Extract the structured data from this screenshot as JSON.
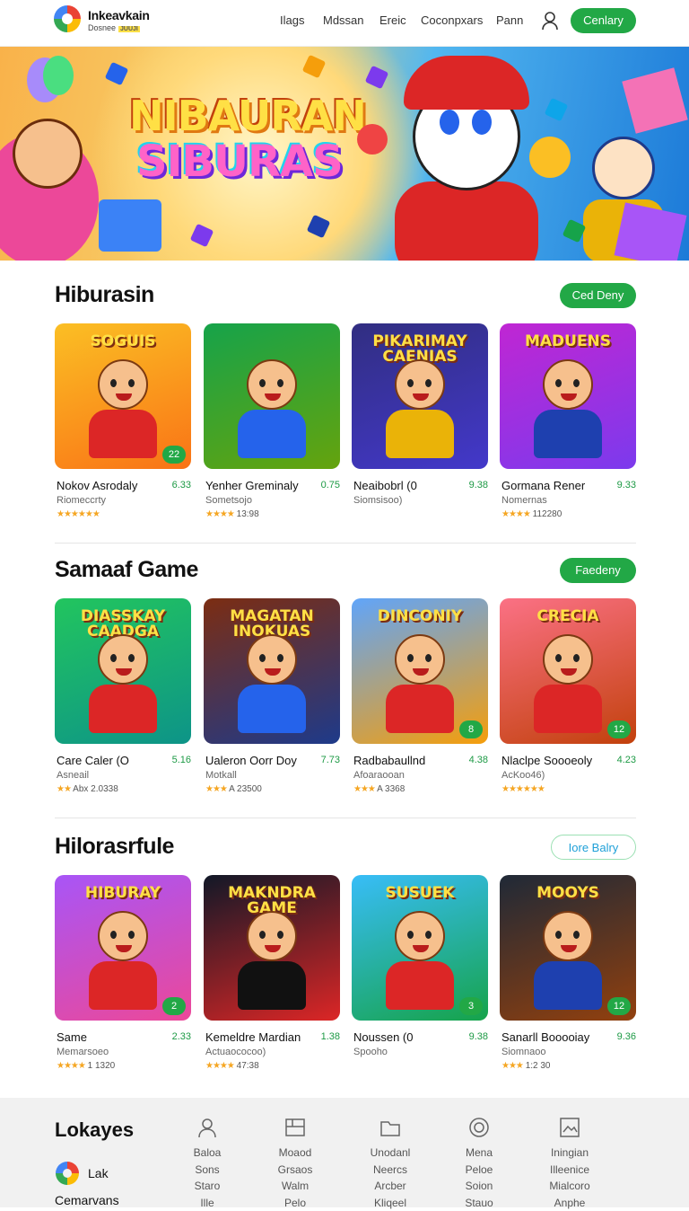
{
  "header": {
    "brand": "Inkeavkain",
    "brand_sub": "Dosnee",
    "brand_tag": "JUUJI",
    "nav": [
      "Ilags",
      "Mdssan",
      "Ereic",
      "Coconpxars",
      "Pann"
    ],
    "cta": "Cenlary",
    "icons": [
      "user-icon"
    ]
  },
  "hero": {
    "title_line1": "NIBAURAN",
    "title_line2": "SIBURAS"
  },
  "sections": [
    {
      "title": "Hiburasin",
      "button": "Ced Deny",
      "cards": [
        {
          "name": "Nokov Asrodaly",
          "score": "6.33",
          "sub": "Riomeccrty",
          "stars": "★★★★★★",
          "rating": "",
          "badge": "22"
        },
        {
          "name": "Yenher Greminaly",
          "score": "0.75",
          "sub": "Sometsojo",
          "stars": "★★★★",
          "rating": "13:98",
          "badge": ""
        },
        {
          "name": "Neaibobrl (0",
          "score": "9.38",
          "sub": "Siomsisoo)",
          "stars": "",
          "rating": "",
          "badge": ""
        },
        {
          "name": "Gormana Rener",
          "score": "9.33",
          "sub": "Nomernas",
          "stars": "★★★★",
          "rating": "112280",
          "badge": ""
        }
      ]
    },
    {
      "title": "Samaaf Game",
      "button": "Faedeny",
      "cards": [
        {
          "name": "Care Caler (O",
          "score": "5.16",
          "sub": "Asneail",
          "stars": "★★",
          "rating": "Abx 2.0338",
          "badge": ""
        },
        {
          "name": "Ualeron Oorr Doy",
          "score": "7.73",
          "sub": "Motkall",
          "stars": "★★★",
          "rating": "A 23500",
          "badge": ""
        },
        {
          "name": "Radbabaullnd",
          "score": "4.38",
          "sub": "Afoaraooan",
          "stars": "★★★",
          "rating": "A 3368",
          "badge": "8"
        },
        {
          "name": "Nlaclpe Soooeoly",
          "score": "4.23",
          "sub": "AcKoo46)",
          "stars": "★★★★★★",
          "rating": "",
          "badge": "12"
        }
      ]
    },
    {
      "title": "Hilorasrfule",
      "button": "Iore Balry",
      "cards": [
        {
          "name": "Same",
          "score": "2.33",
          "sub": "Memarsoeo",
          "stars": "★★★★",
          "rating": "1 1320",
          "badge": "2"
        },
        {
          "name": "Kemeldre Mardian",
          "score": "1.38",
          "sub": "Actuaococoo)",
          "stars": "★★★★",
          "rating": "47:38",
          "badge": ""
        },
        {
          "name": "Noussen (0",
          "score": "9.38",
          "sub": "Spooho",
          "stars": "",
          "rating": "",
          "badge": "3"
        },
        {
          "name": "Sanarll Booooiay",
          "score": "9.36",
          "sub": "Siomnaoo",
          "stars": "★★★",
          "rating": "1:2 30",
          "badge": "12"
        }
      ]
    }
  ],
  "thumb_labels": [
    [
      "SOGUIS",
      "",
      "PIKARIMAY CAENIAS",
      "MADUENS"
    ],
    [
      "DIASSKAY CAADGA",
      "MAGATAN INOKUAS",
      "DINCONIY",
      "CRECIA"
    ],
    [
      "HIBURAY",
      "MAKNDRA GAME",
      "SUSUEK",
      "MOOYS"
    ]
  ],
  "footer": {
    "title": "Lokayes",
    "brand": "Lak",
    "bottom": "Cemarvans",
    "columns": [
      {
        "icon": "person-icon",
        "items": [
          "Baloa",
          "Sons",
          "Staro",
          "Ille"
        ]
      },
      {
        "icon": "image-icon",
        "items": [
          "Moaod",
          "Grsaos",
          "Walm",
          "Pelo"
        ]
      },
      {
        "icon": "folder-icon",
        "items": [
          "Unodanl",
          "Neercs",
          "Arcber",
          "Kliqeel"
        ]
      },
      {
        "icon": "clock-icon",
        "items": [
          "Mena",
          "Peloe",
          "Soion",
          "Stauo"
        ]
      },
      {
        "icon": "gallery-icon",
        "items": [
          "Iningian",
          "Illeenice",
          "Mialcoro",
          "Anphe"
        ]
      }
    ]
  },
  "colors": {
    "accent": "#22a846",
    "score": "#1d9a45",
    "star": "#f5a623"
  }
}
